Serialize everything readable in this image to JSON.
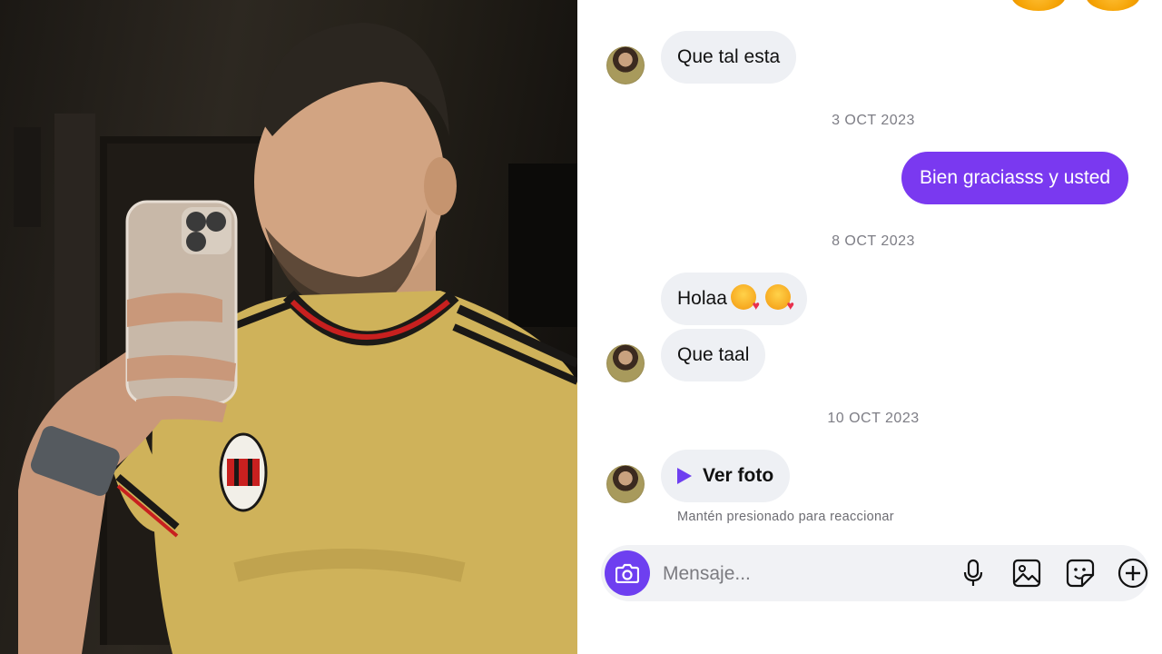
{
  "chat": {
    "messages": [
      {
        "text": "Que tal esta"
      },
      {
        "date": "3 OCT 2023"
      },
      {
        "text": "Bien graciasss y usted"
      },
      {
        "date": "8 OCT 2023"
      },
      {
        "text": "Holaa"
      },
      {
        "text": "Que taal"
      },
      {
        "date": "10 OCT 2023"
      },
      {
        "text": "Ver foto"
      },
      {
        "text": "Mantén presionado para reaccionar"
      }
    ],
    "emojis": [
      "smiling-face-with-hearts",
      "smiling-face-with-hearts"
    ]
  },
  "composer": {
    "placeholder": "Mensaje...",
    "icons": [
      "camera-icon",
      "microphone-icon",
      "image-icon",
      "sticker-icon",
      "plus-icon"
    ],
    "accent": "#6e3ff0"
  },
  "colors": {
    "outgoing_bubble": "#7a39f0",
    "incoming_bubble": "#eef0f4"
  }
}
